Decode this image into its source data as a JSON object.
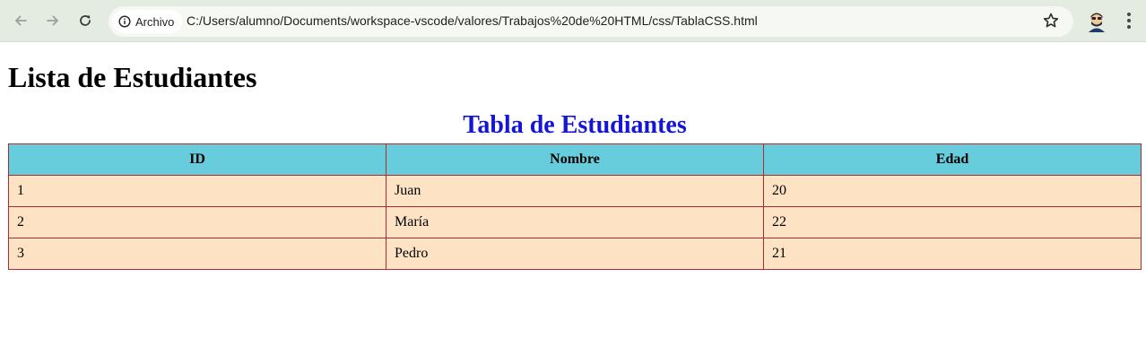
{
  "browser": {
    "security_label": "Archivo",
    "url": "C:/Users/alumno/Documents/workspace-vscode/valores/Trabajos%20de%20HTML/css/TablaCSS.html",
    "icons": [
      "back-arrow-icon",
      "forward-arrow-icon",
      "reload-icon",
      "info-icon",
      "star-icon",
      "profile-avatar",
      "kebab-menu-icon"
    ]
  },
  "page": {
    "heading": "Lista de Estudiantes",
    "caption": "Tabla de Estudiantes"
  },
  "table": {
    "headers": [
      "ID",
      "Nombre",
      "Edad"
    ],
    "rows": [
      [
        "1",
        "Juan",
        "20"
      ],
      [
        "2",
        "María",
        "22"
      ],
      [
        "3",
        "Pedro",
        "21"
      ]
    ]
  },
  "colors": {
    "caption": "#1515d6",
    "header_bg": "#67cddc",
    "cell_bg": "#fde2c4",
    "border": "#b02a30",
    "toolbar_bg": "#e4ebe1"
  }
}
